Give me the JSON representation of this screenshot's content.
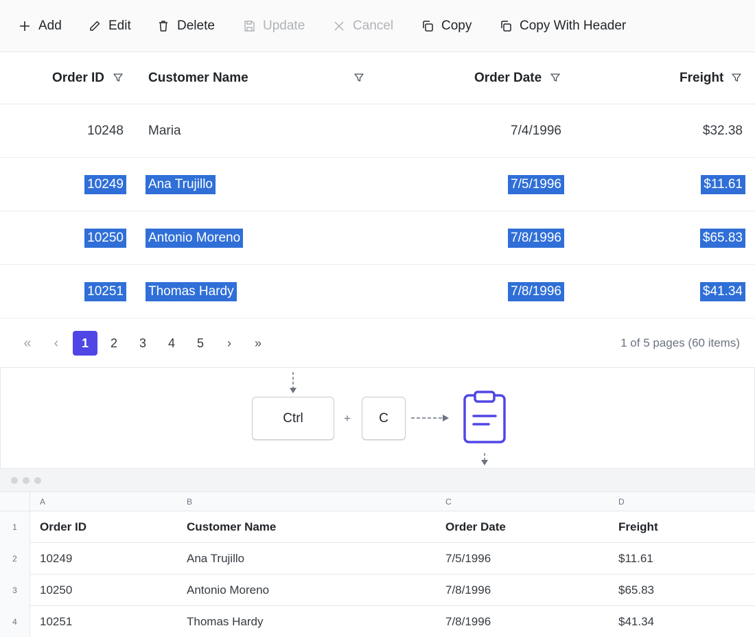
{
  "toolbar": {
    "add": "Add",
    "edit": "Edit",
    "delete": "Delete",
    "update": "Update",
    "cancel": "Cancel",
    "copy": "Copy",
    "copy_with_header": "Copy With Header"
  },
  "grid": {
    "columns": [
      "Order ID",
      "Customer Name",
      "Order Date",
      "Freight"
    ],
    "rows": [
      {
        "order_id": "10248",
        "customer": "Maria",
        "date": "7/4/1996",
        "freight": "$32.38",
        "selected": false
      },
      {
        "order_id": "10249",
        "customer": "Ana Trujillo",
        "date": "7/5/1996",
        "freight": "$11.61",
        "selected": true
      },
      {
        "order_id": "10250",
        "customer": "Antonio Moreno",
        "date": "7/8/1996",
        "freight": "$65.83",
        "selected": true
      },
      {
        "order_id": "10251",
        "customer": "Thomas Hardy",
        "date": "7/8/1996",
        "freight": "$41.34",
        "selected": true
      }
    ],
    "selection_color": "#2f6fd7"
  },
  "pager": {
    "first": "«",
    "prev": "‹",
    "pages": [
      "1",
      "2",
      "3",
      "4",
      "5"
    ],
    "current_page": "1",
    "next": "›",
    "last": "»",
    "info": "1 of 5 pages (60 items)",
    "active_color": "#4f46e5"
  },
  "illustration": {
    "key1": "Ctrl",
    "plus": "+",
    "key2": "C",
    "icon": "clipboard-icon",
    "icon_color": "#5046e5"
  },
  "sheet": {
    "column_letters": [
      "A",
      "B",
      "C",
      "D"
    ],
    "row_numbers": [
      "1",
      "2",
      "3",
      "4"
    ],
    "rows": [
      [
        "Order ID",
        "Customer Name",
        "Order Date",
        "Freight"
      ],
      [
        "10249",
        "Ana Trujillo",
        "7/5/1996",
        "$11.61"
      ],
      [
        "10250",
        "Antonio Moreno",
        "7/8/1996",
        "$65.83"
      ],
      [
        "10251",
        "Thomas Hardy",
        "7/8/1996",
        "$41.34"
      ]
    ]
  }
}
